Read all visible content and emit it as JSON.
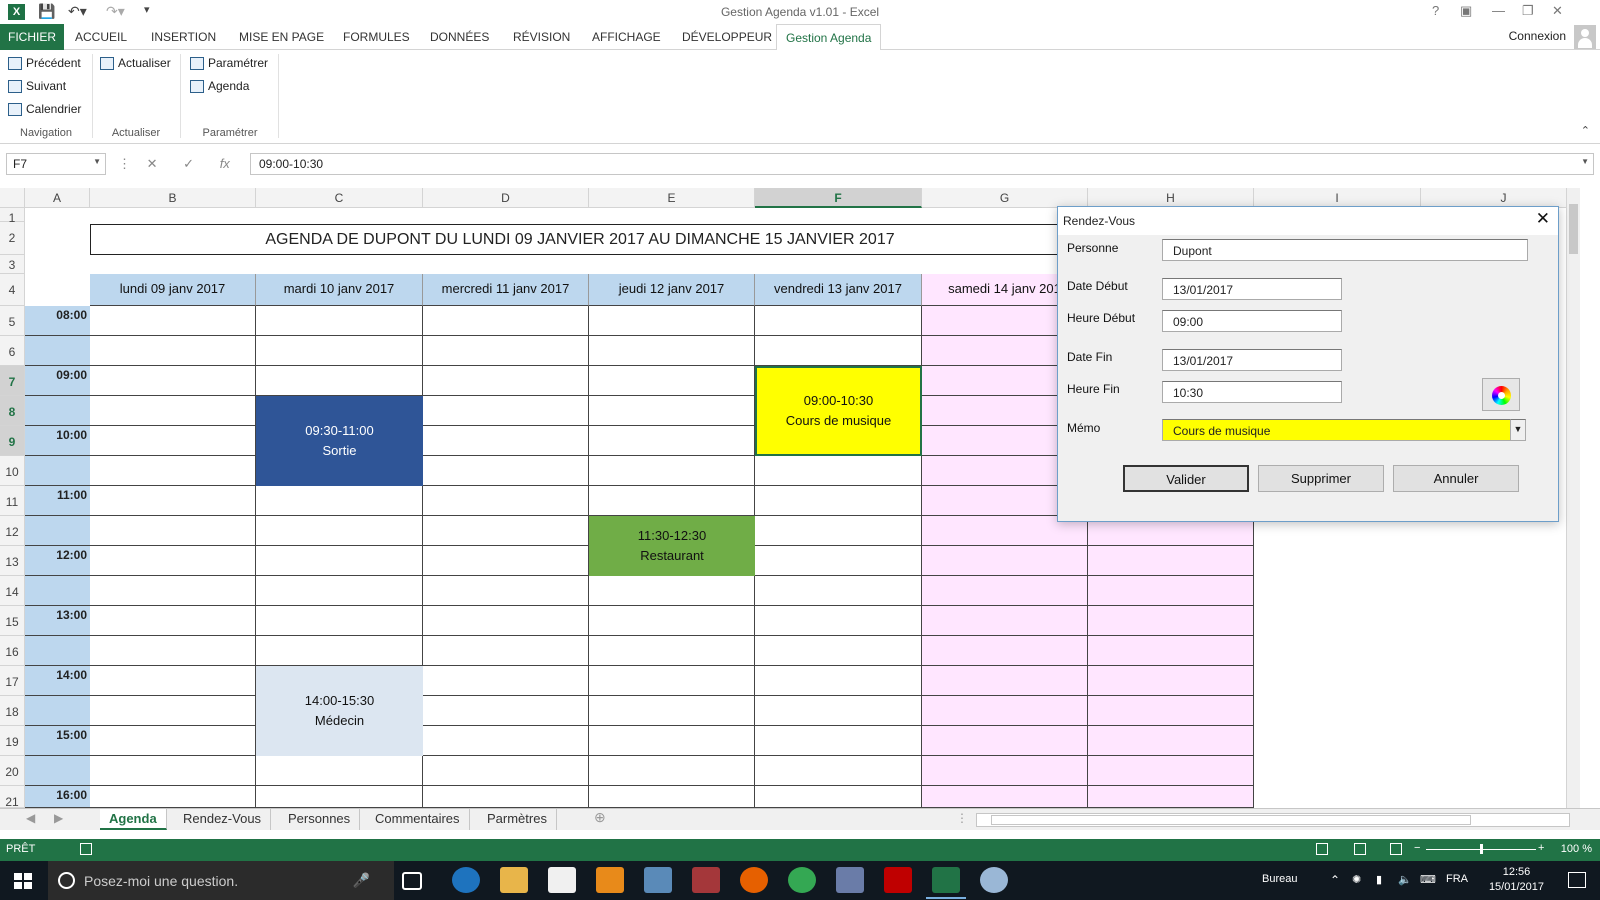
{
  "window": {
    "title": "Gestion Agenda v1.01 - Excel"
  },
  "ribbon_tabs": [
    "FICHIER",
    "ACCUEIL",
    "INSERTION",
    "MISE EN PAGE",
    "FORMULES",
    "DONNÉES",
    "RÉVISION",
    "AFFICHAGE",
    "DÉVELOPPEUR",
    "Gestion Agenda"
  ],
  "active_ribbon_tab": "Gestion Agenda",
  "user": "Connexion",
  "ribbon": {
    "navigation": {
      "label": "Navigation",
      "precedent": "Précédent",
      "suivant": "Suivant",
      "calendrier": "Calendrier"
    },
    "actualiser": {
      "label": "Actualiser",
      "button": "Actualiser"
    },
    "parametrer": {
      "label": "Paramétrer",
      "button": "Paramétrer",
      "agenda": "Agenda"
    }
  },
  "formula_bar": {
    "name_box": "F7",
    "formula": "09:00-10:30"
  },
  "columns": [
    "A",
    "B",
    "C",
    "D",
    "E",
    "F",
    "G",
    "H",
    "I",
    "J"
  ],
  "selected_column": "F",
  "rows": [
    "1",
    "2",
    "3",
    "4",
    "5",
    "6",
    "7",
    "8",
    "9",
    "10",
    "11",
    "12",
    "13",
    "14",
    "15",
    "16",
    "17",
    "18",
    "19",
    "20",
    "21"
  ],
  "sheet": {
    "title": "AGENDA DE DUPONT DU LUNDI 09 JANVIER 2017 AU DIMANCHE 15 JANVIER 2017",
    "days": [
      "lundi 09 janv 2017",
      "mardi 10 janv 2017",
      "mercredi 11 janv 2017",
      "jeudi 12 janv 2017",
      "vendredi 13 janv 2017",
      "samedi 14 janv 201"
    ],
    "times": [
      "08:00",
      "09:00",
      "10:00",
      "11:00",
      "12:00",
      "13:00",
      "14:00",
      "15:00",
      "16:00"
    ],
    "events": [
      {
        "time": "09:30-11:00",
        "label": "Sortie",
        "color": "#2f5597",
        "text_color": "#ffffff"
      },
      {
        "time": "09:00-10:30",
        "label": "Cours de musique",
        "color": "#ffff00",
        "text_color": "#111111"
      },
      {
        "time": "11:30-12:30",
        "label": "Restaurant",
        "color": "#70ad47",
        "text_color": "#111111"
      },
      {
        "time": "14:00-15:30",
        "label": "Médecin",
        "color": "#dce6f1",
        "text_color": "#111111"
      }
    ]
  },
  "dialog": {
    "title": "Rendez-Vous",
    "labels": {
      "personne": "Personne",
      "date_debut": "Date Début",
      "heure_debut": "Heure Début",
      "date_fin": "Date Fin",
      "heure_fin": "Heure Fin",
      "memo": "Mémo"
    },
    "values": {
      "personne": "Dupont",
      "date_debut": "13/01/2017",
      "heure_debut": "09:00",
      "date_fin": "13/01/2017",
      "heure_fin": "10:30",
      "memo": "Cours de musique"
    },
    "memo_color": "#ffff00",
    "buttons": {
      "valider": "Valider",
      "supprimer": "Supprimer",
      "annuler": "Annuler"
    }
  },
  "sheet_tabs": [
    "Agenda",
    "Rendez-Vous",
    "Personnes",
    "Commentaires",
    "Parmètres"
  ],
  "active_sheet_tab": "Agenda",
  "status": {
    "mode": "PRÊT",
    "zoom": "100 %"
  },
  "taskbar": {
    "search_placeholder": "Posez-moi une question.",
    "bureau": "Bureau",
    "lang": "FRA",
    "time": "12:56",
    "date": "15/01/2017"
  },
  "colors": {
    "excel_green": "#217346",
    "header_blue": "#bdd7ee",
    "weekend_pink": "#ffe6ff"
  }
}
